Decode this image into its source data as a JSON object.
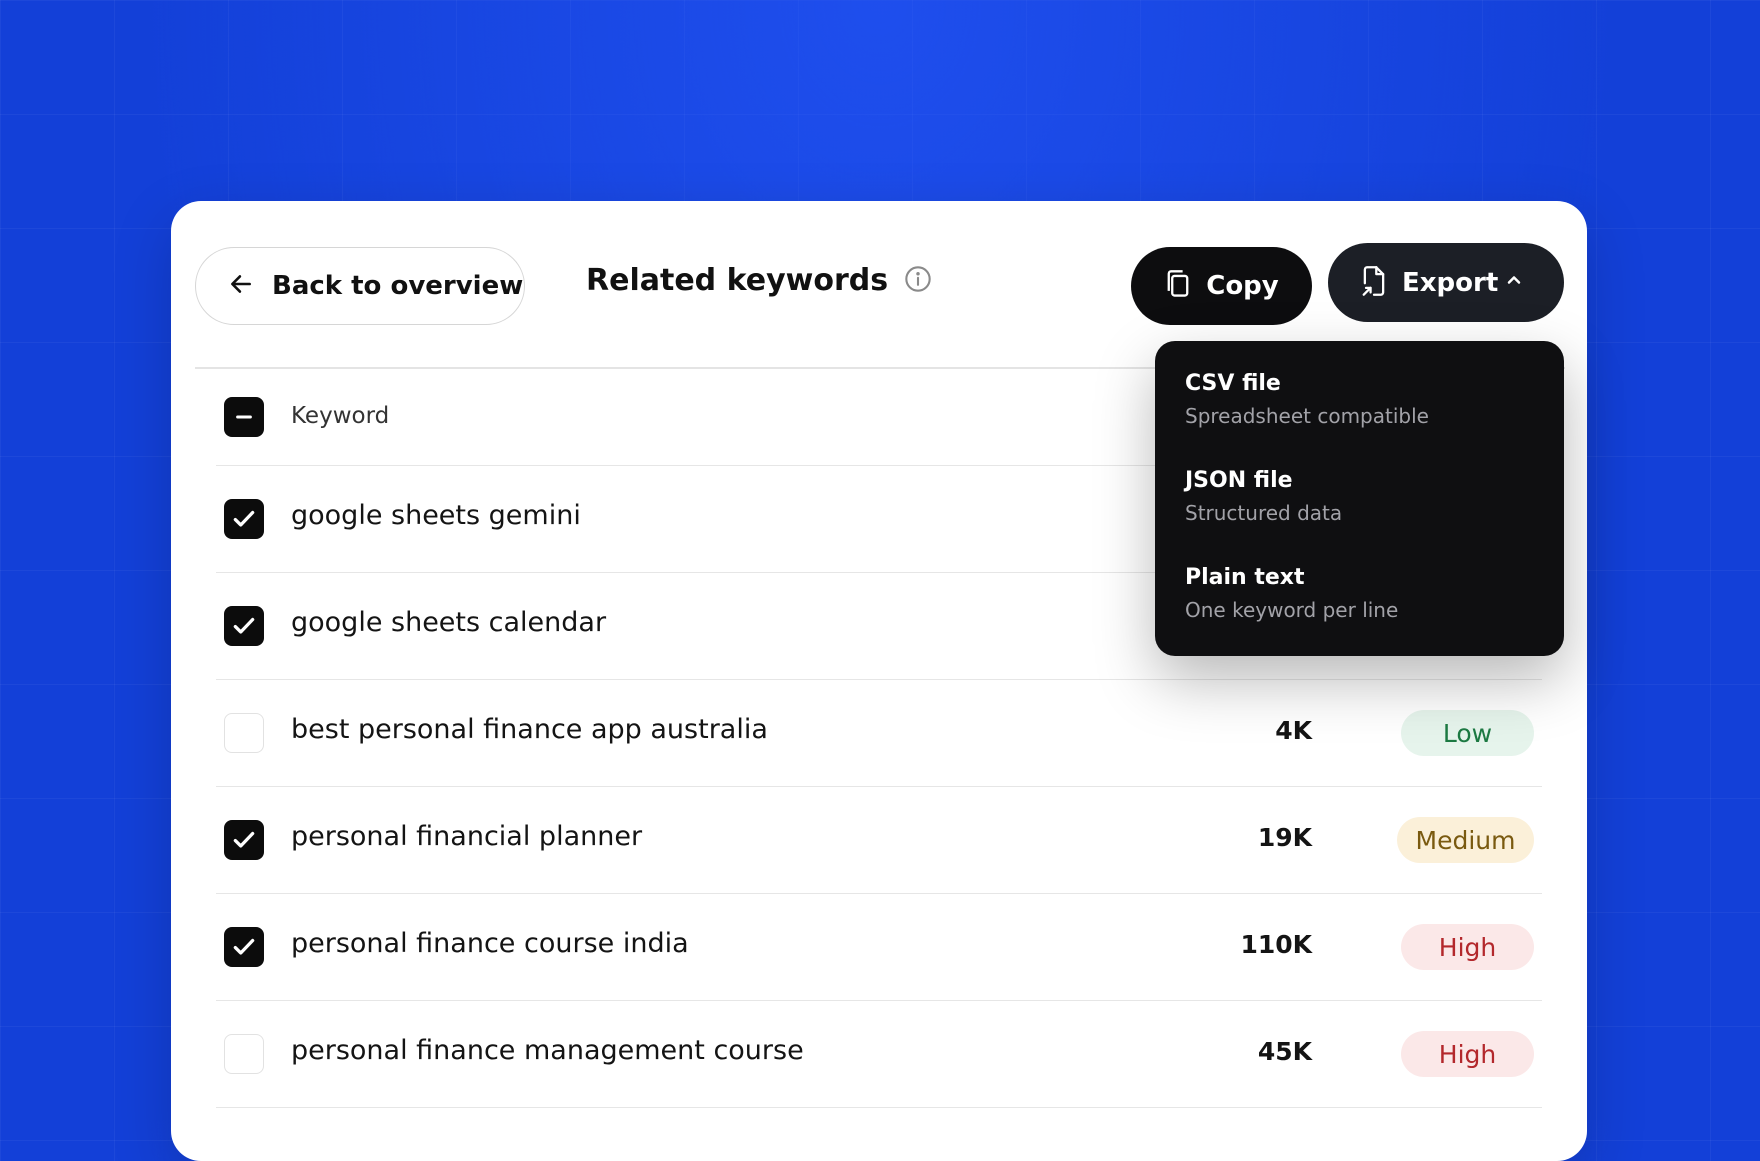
{
  "header": {
    "back_label": "Back to overview",
    "title": "Related keywords",
    "copy_label": "Copy",
    "export_label": "Export"
  },
  "table": {
    "header_label": "Keyword",
    "rows": [
      {
        "keyword": "google sheets gemini",
        "checked": true,
        "volume": "",
        "difficulty": ""
      },
      {
        "keyword": "google sheets calendar",
        "checked": true,
        "volume": "",
        "difficulty": ""
      },
      {
        "keyword": "best personal finance app australia",
        "checked": false,
        "volume": "4K",
        "difficulty": "Low"
      },
      {
        "keyword": "personal financial planner",
        "checked": true,
        "volume": "19K",
        "difficulty": "Medium"
      },
      {
        "keyword": "personal finance course india",
        "checked": true,
        "volume": "110K",
        "difficulty": "High"
      },
      {
        "keyword": "personal finance management course",
        "checked": false,
        "volume": "45K",
        "difficulty": "High"
      }
    ]
  },
  "export_menu": {
    "items": [
      {
        "title": "CSV file",
        "subtitle": "Spreadsheet compatible"
      },
      {
        "title": "JSON file",
        "subtitle": "Structured data"
      },
      {
        "title": "Plain text",
        "subtitle": "One keyword per line"
      }
    ]
  },
  "icons": {
    "back": "arrow-left-icon",
    "info": "info-icon",
    "copy": "copy-icon",
    "export": "file-export-icon",
    "chevron": "chevron-up-icon"
  },
  "colors": {
    "background": "#1340d8",
    "low": "#1d7a43",
    "medium": "#7a5a10",
    "high": "#b3282c"
  }
}
